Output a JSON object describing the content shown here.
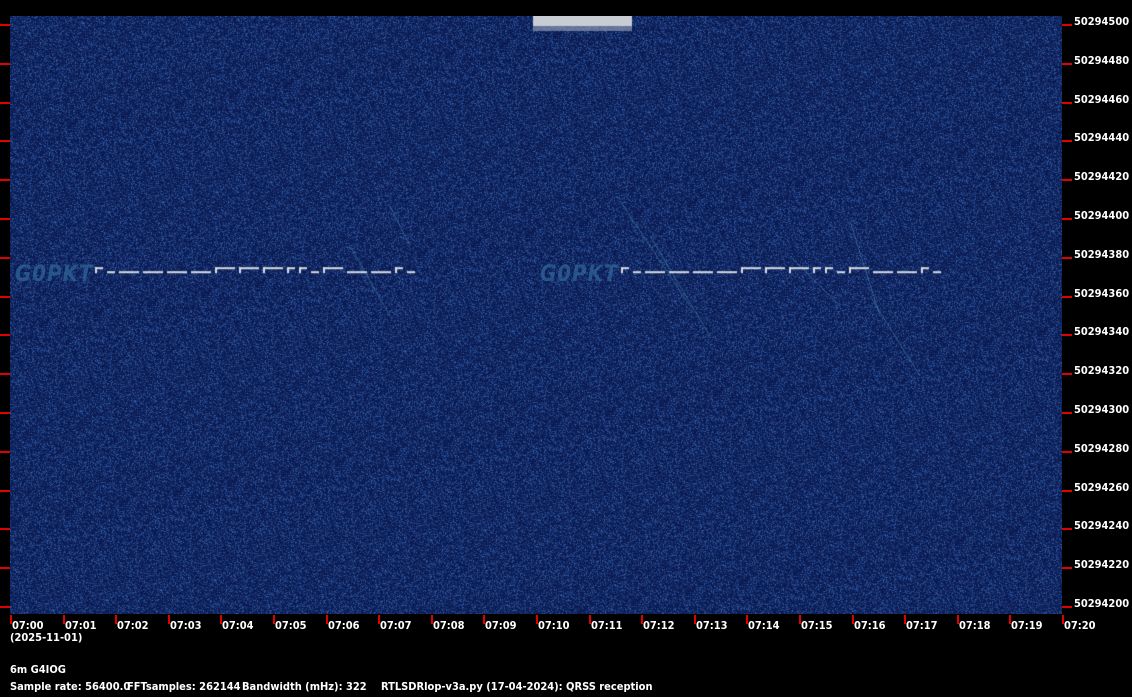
{
  "chart_data": {
    "type": "heatmap",
    "title": "",
    "x_date": "(2025-11-01)",
    "x_ticks": [
      "07:00",
      "07:01",
      "07:02",
      "07:03",
      "07:04",
      "07:05",
      "07:06",
      "07:07",
      "07:08",
      "07:09",
      "07:10",
      "07:11",
      "07:12",
      "07:13",
      "07:14",
      "07:15",
      "07:16",
      "07:17",
      "07:18",
      "07:19",
      "07:20"
    ],
    "y_ticks": [
      "50294500",
      "50294480",
      "50294460",
      "50294440",
      "50294420",
      "50294400",
      "50294380",
      "50294360",
      "50294340",
      "50294320",
      "50294300",
      "50294280",
      "50294260",
      "50294240",
      "50294220",
      "50294200"
    ],
    "xlim": [
      "07:00",
      "07:20"
    ],
    "ylim": [
      50294200,
      50294500
    ],
    "signals": [
      {
        "label": "G0PKT",
        "start": "07:00",
        "end": "07:07",
        "freq": 50294370
      },
      {
        "label": "G0PKT",
        "start": "07:10",
        "end": "07:17",
        "freq": 50294370
      }
    ],
    "colors": {
      "background": "#0a1e5a",
      "signal": "#d8dce0",
      "tick": "#e00000"
    }
  },
  "footer": {
    "station": "6m G4IOG",
    "sample_rate": "Sample rate: 56400.0",
    "fft": "FFTsamples: 262144",
    "bandwidth": "Bandwidth (mHz): 322",
    "software": "RTLSDRlop-v3a.py (17-04-2024): QRSS reception"
  }
}
